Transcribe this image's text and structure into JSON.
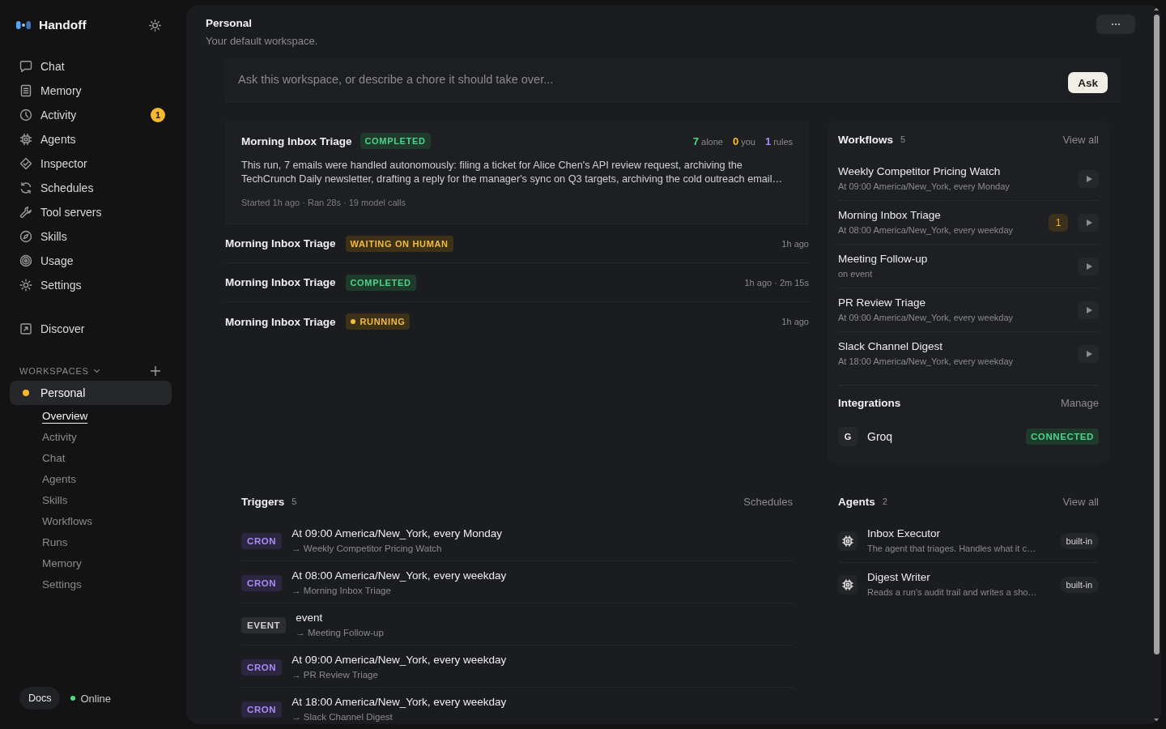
{
  "sidebar": {
    "brand": "Handoff",
    "nav": [
      {
        "label": "Chat",
        "selected": false
      },
      {
        "label": "Memory",
        "selected": false
      },
      {
        "label": "Activity",
        "selected": false,
        "badge": "1"
      },
      {
        "label": "Agents",
        "selected": false
      },
      {
        "label": "Inspector",
        "selected": false
      },
      {
        "label": "Schedules",
        "selected": false
      },
      {
        "label": "Tool servers",
        "selected": false
      },
      {
        "label": "Skills",
        "selected": false
      },
      {
        "label": "Usage",
        "selected": false
      },
      {
        "label": "Settings",
        "selected": false
      }
    ],
    "discover": {
      "label": "Discover",
      "selected": false
    },
    "workspaces": {
      "label": "WORKSPACES",
      "items": [
        {
          "name": "Personal",
          "color": "#f5b82e",
          "selected": true,
          "children": [
            {
              "label": "Overview",
              "selected": true
            },
            {
              "label": "Activity",
              "selected": false
            },
            {
              "label": "Chat",
              "selected": false
            },
            {
              "label": "Agents",
              "selected": false
            },
            {
              "label": "Skills",
              "selected": false
            },
            {
              "label": "Workflows",
              "selected": false
            },
            {
              "label": "Runs",
              "selected": false
            },
            {
              "label": "Memory",
              "selected": false
            },
            {
              "label": "Settings",
              "selected": false
            }
          ]
        }
      ]
    },
    "footer": {
      "docs": "Docs",
      "status": "Online",
      "online": true
    }
  },
  "header": {
    "title": "Personal",
    "subtitle": "Your default workspace."
  },
  "ask": {
    "placeholder": "Ask this workspace, or describe a chore it should take over...",
    "button": "Ask"
  },
  "runs": [
    {
      "title": "Morning Inbox Triage",
      "status": "COMPLETED",
      "kind": "completed",
      "expanded": true,
      "stats": [
        {
          "count": "7",
          "caption": "alone",
          "color": "#4ade80"
        },
        {
          "count": "0",
          "caption": "you",
          "color": "#fbbf24"
        },
        {
          "count": "1",
          "caption": "rules",
          "color": "#a78bfa"
        }
      ],
      "summary": "This run, 7 emails were handled autonomously: filing a ticket for Alice Chen's API review request, archiving the TechCrunch Daily newsletter, drafting a reply for the manager's sync on Q3 targets, archiving the cold outreach email…",
      "meta": "Started 1h ago · Ran 28s · 19 model calls"
    },
    {
      "title": "Morning Inbox Triage",
      "status": "WAITING ON HUMAN",
      "kind": "waiting",
      "expanded": false,
      "time": "1h ago"
    },
    {
      "title": "Morning Inbox Triage",
      "status": "COMPLETED",
      "kind": "completed",
      "expanded": false,
      "time": "1h ago · 2m 15s"
    },
    {
      "title": "Morning Inbox Triage",
      "status": "RUNNING",
      "kind": "running",
      "expanded": false,
      "time": "1h ago"
    }
  ],
  "workflows": {
    "title": "Workflows",
    "count": "5",
    "link": "View all",
    "items": [
      {
        "name": "Weekly Competitor Pricing Watch",
        "schedule": "At 09:00 America/New_York, every Monday"
      },
      {
        "name": "Morning Inbox Triage",
        "schedule": "At 08:00 America/New_York, every weekday",
        "badge": "1"
      },
      {
        "name": "Meeting Follow-up",
        "schedule": "on event"
      },
      {
        "name": "PR Review Triage",
        "schedule": "At 09:00 America/New_York, every weekday"
      },
      {
        "name": "Slack Channel Digest",
        "schedule": "At 18:00 America/New_York, every weekday"
      }
    ]
  },
  "integrations": {
    "title": "Integrations",
    "link": "Manage",
    "items": [
      {
        "initial": "G",
        "name": "Groq",
        "status": "CONNECTED",
        "connected": true
      }
    ]
  },
  "triggers": {
    "title": "Triggers",
    "count": "5",
    "link": "Schedules",
    "items": [
      {
        "badge": "CRON",
        "kind": "cron",
        "title": "At 09:00 America/New_York, every Monday",
        "target": "→ Weekly Competitor Pricing Watch"
      },
      {
        "badge": "CRON",
        "kind": "cron",
        "title": "At 08:00 America/New_York, every weekday",
        "target": "→ Morning Inbox Triage"
      },
      {
        "badge": "EVENT",
        "kind": "event",
        "title": "event",
        "target": "→ Meeting Follow-up"
      },
      {
        "badge": "CRON",
        "kind": "cron",
        "title": "At 09:00 America/New_York, every weekday",
        "target": "→ PR Review Triage"
      },
      {
        "badge": "CRON",
        "kind": "cron",
        "title": "At 18:00 America/New_York, every weekday",
        "target": "→ Slack Channel Digest"
      }
    ]
  },
  "agents": {
    "title": "Agents",
    "count": "2",
    "link": "View all",
    "items": [
      {
        "name": "Inbox Executor",
        "description": "The agent that triages. Handles what it c…",
        "tag": "built-in"
      },
      {
        "name": "Digest Writer",
        "description": "Reads a run's audit trail and writes a sho…",
        "tag": "built-in"
      }
    ]
  }
}
